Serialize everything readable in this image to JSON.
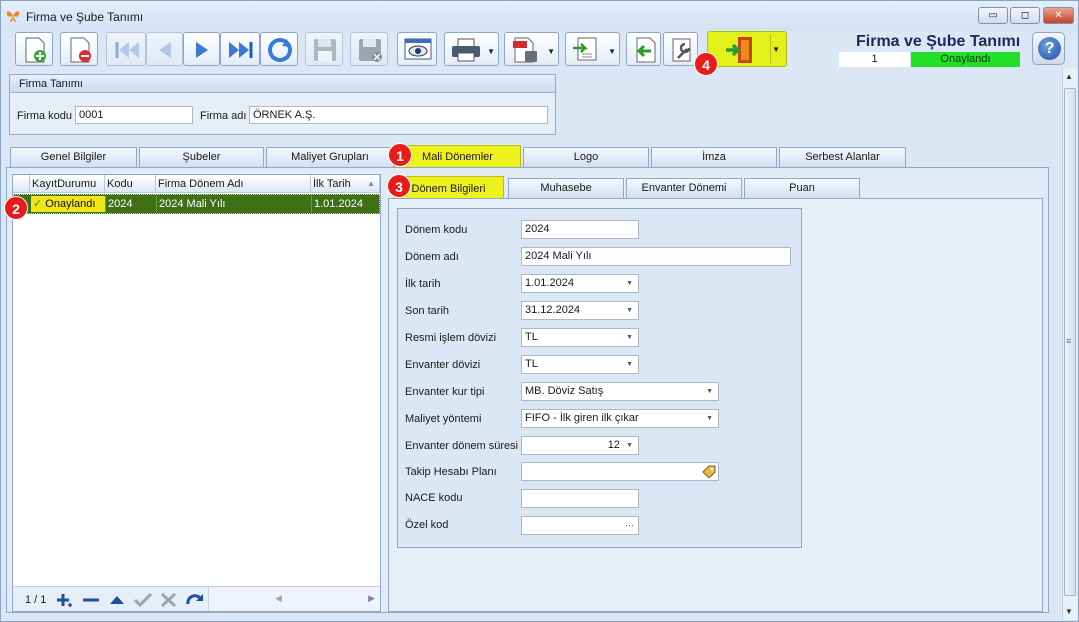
{
  "window": {
    "title": "Firma ve Şube Tanımı",
    "min_glyph": "▭",
    "max_glyph": "◻",
    "close_glyph": "✕"
  },
  "header": {
    "title": "Firma ve Şube Tanımı",
    "record_number": "1",
    "status": "Onaylandı"
  },
  "toolbar": {
    "icons": [
      "new-record-icon",
      "delete-record-icon",
      "first-record-icon",
      "previous-record-icon",
      "next-record-icon",
      "last-record-icon",
      "refresh-icon",
      "save-icon",
      "cancel-save-icon",
      "preview-icon",
      "print-icon",
      "pdf-export-icon",
      "export-icon",
      "back-icon",
      "tools-icon",
      "exit-icon",
      "help-icon"
    ],
    "help_glyph": "?"
  },
  "company": {
    "group_title": "Firma Tanımı",
    "code_label": "Firma kodu",
    "code_value": "0001",
    "name_label": "Firma adı",
    "name_value": "ÖRNEK A.Ş."
  },
  "main_tabs": [
    "Genel Bilgiler",
    "Şubeler",
    "Maliyet Grupları",
    "Mali Dönemler",
    "Logo",
    "İmza",
    "Serbest Alanlar"
  ],
  "grid": {
    "columns": [
      "KayıtDurumu",
      "Kodu",
      "Firma Dönem Adı",
      "İlk Tarih"
    ],
    "rows": [
      {
        "status": "Onaylandı",
        "code": "2024",
        "name": "2024 Mali Yılı",
        "start": "1.01.2024"
      }
    ],
    "pager": "1 / 1"
  },
  "sub_tabs": [
    "Dönem Bilgileri",
    "Muhasebe",
    "Envanter Dönemi",
    "Puan"
  ],
  "form": {
    "period_code_label": "Dönem kodu",
    "period_code": "2024",
    "period_name_label": "Dönem adı",
    "period_name": "2024 Mali Yılı",
    "start_date_label": "İlk tarih",
    "start_date": "1.01.2024",
    "end_date_label": "Son tarih",
    "end_date": "31.12.2024",
    "official_currency_label": "Resmi işlem dövizi",
    "official_currency": "TL",
    "inventory_currency_label": "Envanter dövizi",
    "inventory_currency": "TL",
    "inventory_rate_type_label": "Envanter kur tipi",
    "inventory_rate_type": "MB. Döviz Satış",
    "cost_method_label": "Maliyet yöntemi",
    "cost_method": "FIFO - İlk giren ilk çıkar",
    "inventory_period_duration_label": "Envanter dönem süresi",
    "inventory_period_duration": "12",
    "tracking_account_plan_label": "Takip Hesabı Planı",
    "tracking_account_plan": "",
    "nace_code_label": "NACE kodu",
    "nace_code": "",
    "special_code_label": "Özel kod",
    "special_code": "",
    "ellipsis": "···"
  },
  "badges": [
    "1",
    "2",
    "3",
    "4"
  ],
  "colors": {
    "highlight": "#eef11c",
    "approved": "#22e028",
    "selected_row": "#3f6f17",
    "badge": "#e81b1b"
  }
}
